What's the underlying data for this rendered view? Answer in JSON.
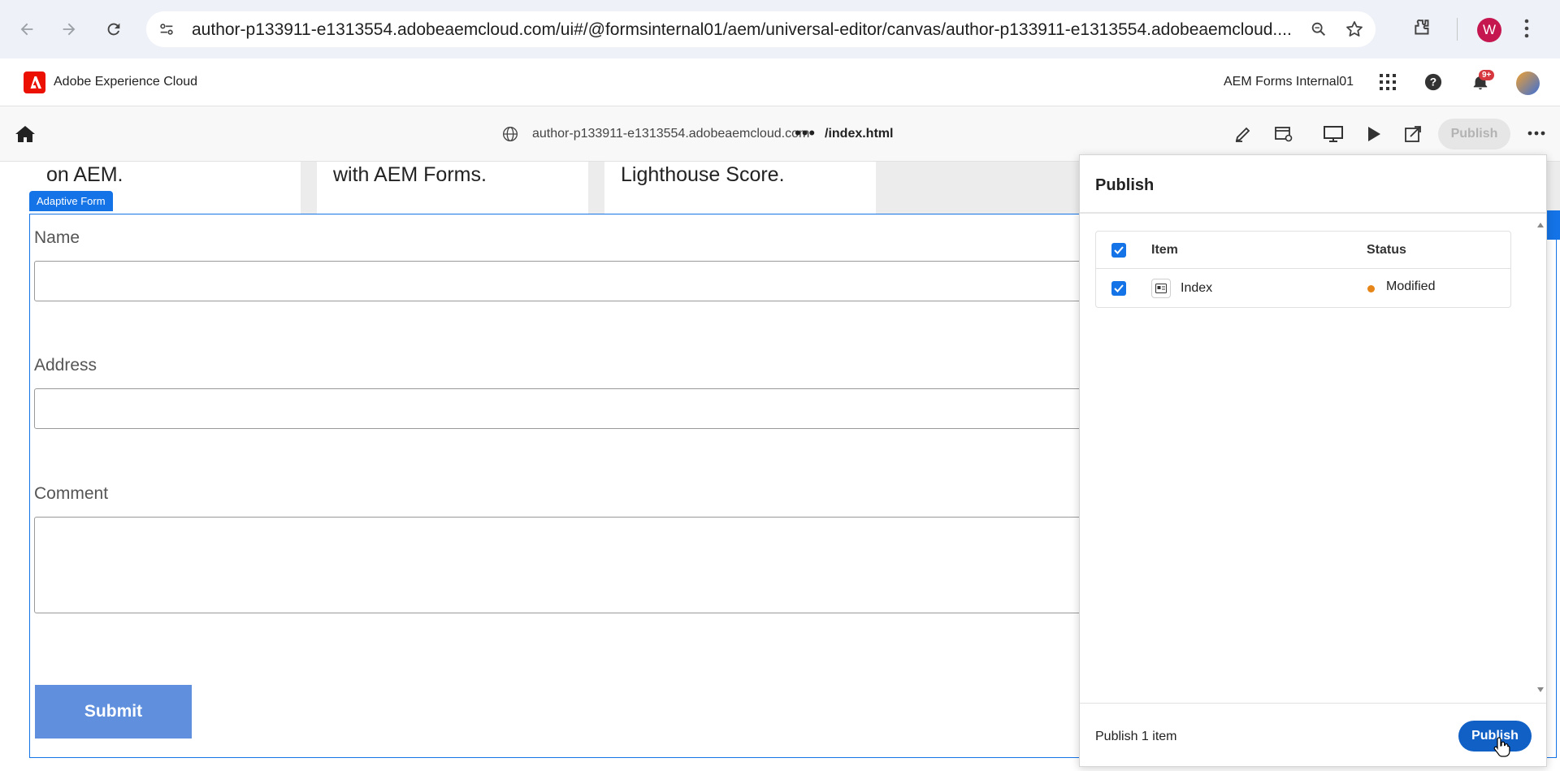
{
  "browser": {
    "url": "author-p133911-e1313554.adobeaemcloud.com/ui#/@formsinternal01/aem/universal-editor/canvas/author-p133911-e1313554.adobeaemcloud....",
    "profile_initial": "W"
  },
  "shell": {
    "title": "Adobe Experience Cloud",
    "org_name": "AEM Forms Internal01",
    "notification_count": "9+"
  },
  "toolbar": {
    "host": "author-p133911-e1313554.adobeaemcloud.com",
    "more": "•••",
    "path": "/index.html",
    "publish_label": "Publish"
  },
  "canvas": {
    "cards": [
      "on AEM.",
      "with AEM Forms.",
      "Lighthouse Score."
    ],
    "form_tag": "Adaptive Form",
    "fields": {
      "name_label": "Name",
      "address_label": "Address",
      "comment_label": "Comment"
    },
    "submit_label": "Submit"
  },
  "publish_panel": {
    "title": "Publish",
    "columns": {
      "item": "Item",
      "status": "Status"
    },
    "rows": [
      {
        "item": "Index",
        "status": "Modified",
        "status_color": "#e68619"
      }
    ],
    "footer_text": "Publish 1 item",
    "publish_label": "Publish"
  },
  "colors": {
    "accent": "#1473e6",
    "publish_button": "#1160c6",
    "adobe_red": "#eb1000",
    "submit_button": "#5f8fdd"
  }
}
